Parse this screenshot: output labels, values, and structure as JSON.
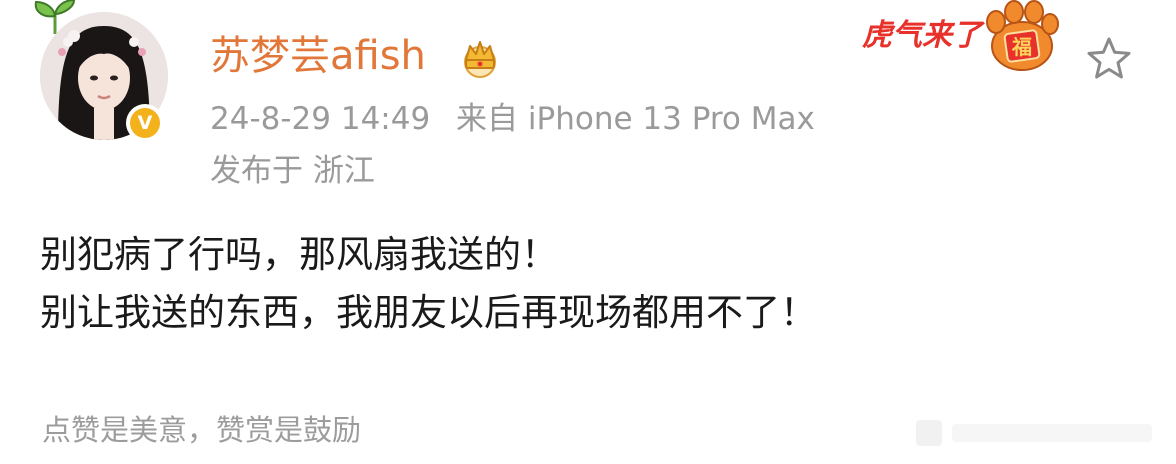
{
  "post": {
    "username": "苏梦芸afish",
    "timestamp": "24-8-29 14:49",
    "source": "来自 iPhone 13 Pro Max",
    "location": "发布于 浙江",
    "content_lines": [
      "别犯病了行吗，那风扇我送的！",
      "别让我送的东西，我朋友以后再现场都用不了！"
    ],
    "verified_badge": "V"
  },
  "decorations": {
    "year_badge_text": "虎气来了",
    "paw_text": "福",
    "crown_icon": "crown-icon",
    "star_icon": "star-outline-icon"
  },
  "footer": {
    "tip_text": "点赞是美意，赞赏是鼓励"
  },
  "colors": {
    "username": "#e1783a",
    "meta": "#9a9a9a",
    "body": "#1a1a1a",
    "verified": "#f3b21b",
    "badge_red": "#e8312b"
  }
}
